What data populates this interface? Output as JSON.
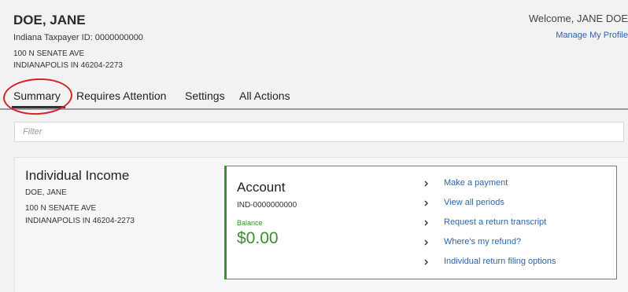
{
  "header": {
    "name": "DOE, JANE",
    "taxpayer_id": "Indiana Taxpayer ID: 0000000000",
    "address_line1": "100 N SENATE AVE",
    "address_line2": "INDIANAPOLIS IN 46204-2273",
    "welcome": "Welcome, JANE DOE",
    "manage_profile": "Manage My Profile"
  },
  "tabs": [
    {
      "label": "Summary",
      "active": true
    },
    {
      "label": "Requires Attention",
      "active": false
    },
    {
      "label": "Settings",
      "active": false
    },
    {
      "label": "All Actions",
      "active": false
    }
  ],
  "filter": {
    "placeholder": "Filter",
    "value": ""
  },
  "card": {
    "title": "Individual Income",
    "name": "DOE, JANE",
    "address_line1": "100 N SENATE AVE",
    "address_line2": "INDIANAPOLIS IN 46204-2273",
    "account": {
      "title": "Account",
      "id": "IND-0000000000",
      "balance_label": "Balance",
      "balance_value": "$0.00"
    },
    "links": [
      {
        "label": "Make a payment",
        "icon": "chevron-right-icon"
      },
      {
        "label": "View all periods",
        "icon": "chevron-right-icon"
      },
      {
        "label": "Request a return transcript",
        "icon": "chevron-right-icon"
      },
      {
        "label": "Where's my refund?",
        "icon": "chevron-right-icon"
      },
      {
        "label": "Individual return filing options",
        "icon": "chevron-right-icon"
      }
    ]
  },
  "colors": {
    "link": "#2f64a4",
    "balance": "#3a8f2e",
    "highlight_circle": "#d2232a"
  }
}
